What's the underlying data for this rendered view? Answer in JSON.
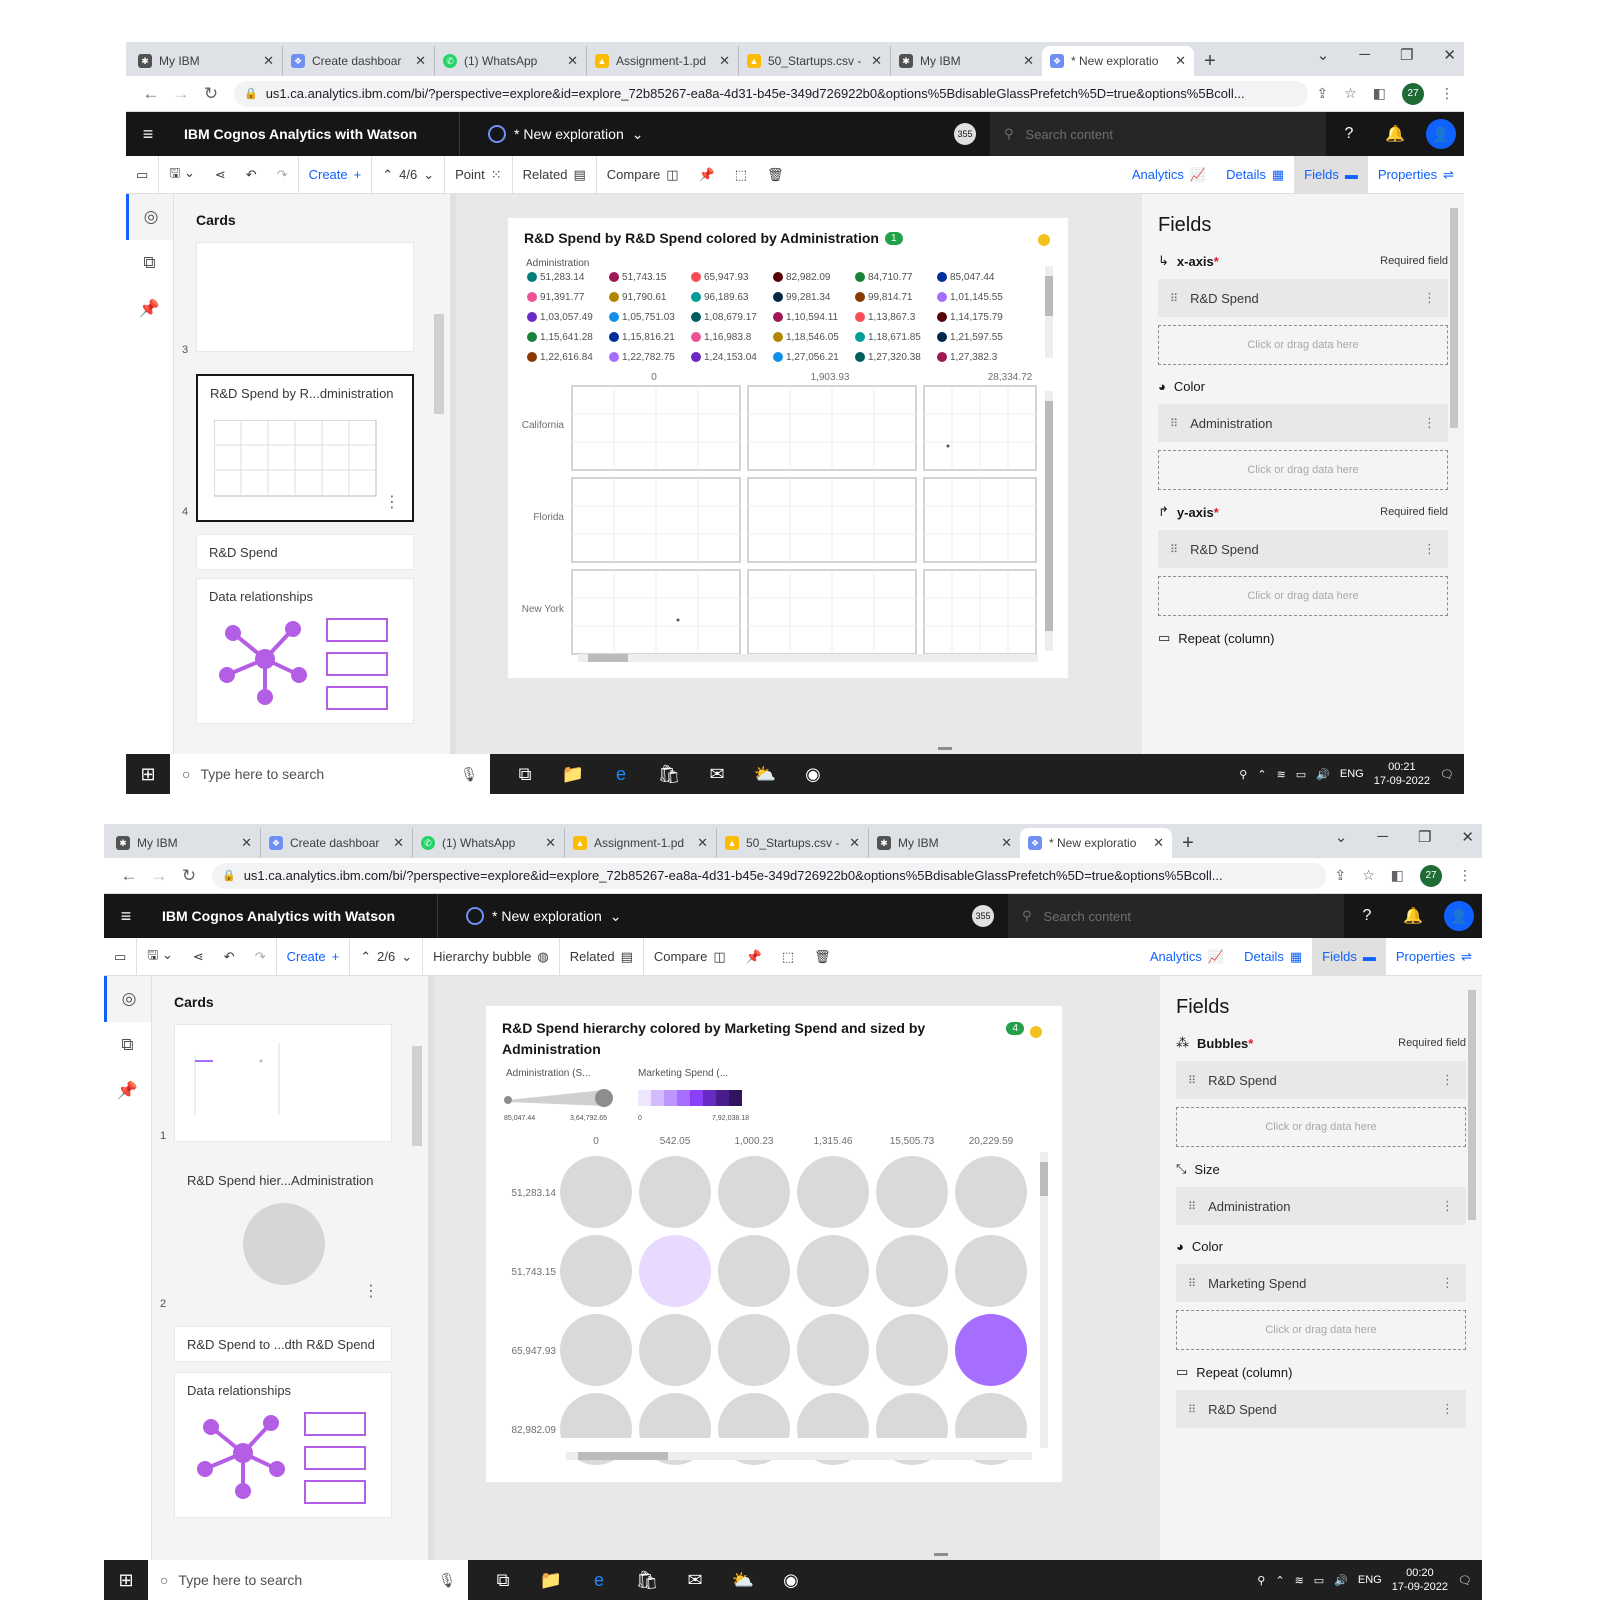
{
  "browser_tabs": [
    "My IBM",
    "Create dashboar",
    "(1) WhatsApp",
    "Assignment-1.pd",
    "50_Startups.csv -",
    "My IBM",
    "* New exploratio"
  ],
  "url": "us1.ca.analytics.ibm.com/bi/?perspective=explore&id=explore_72b85267-ea8a-4d31-b45e-349d726922b0&options%5BdisableGlassPrefetch%5D=true&options%5Bcoll...",
  "profile_badge": "27",
  "app_title": "IBM Cognos Analytics with Watson",
  "exploration_label": "* New exploration",
  "notifications_badge": "355",
  "search_placeholder": "Search content",
  "toolbar": {
    "create": "Create",
    "related": "Related",
    "compare": "Compare",
    "analytics": "Analytics",
    "details": "Details",
    "fields": "Fields",
    "properties": "Properties"
  },
  "cards_heading": "Cards",
  "fields_heading": "Fields",
  "required_field": "Required field",
  "drop_hint": "Click or drag data here",
  "data_relationships": "Data relationships",
  "taskbar": {
    "search": "Type here to search",
    "lang": "ENG",
    "date": "17-09-2022"
  },
  "shot1": {
    "page_pos": "4/6",
    "viz_type": "Point",
    "time": "00:21",
    "cards": [
      {
        "num": "3",
        "title": ""
      },
      {
        "num": "4",
        "title": "R&D Spend by R...dministration"
      },
      {
        "num": "",
        "title": "R&D Spend"
      }
    ],
    "viz_title": "R&D Spend by R&D Spend colored by Administration",
    "viz_count": "1",
    "legend_title": "Administration",
    "legend": [
      {
        "label": "51,283.14",
        "color": "#007d79"
      },
      {
        "label": "51,743.15",
        "color": "#9f1853"
      },
      {
        "label": "65,947.93",
        "color": "#fa4d56"
      },
      {
        "label": "82,982.09",
        "color": "#570408"
      },
      {
        "label": "84,710.77",
        "color": "#198038"
      },
      {
        "label": "85,047.44",
        "color": "#002d9c"
      },
      {
        "label": "91,391.77",
        "color": "#ee5396"
      },
      {
        "label": "91,790.61",
        "color": "#b28600"
      },
      {
        "label": "96,189.63",
        "color": "#009d9a"
      },
      {
        "label": "99,281.34",
        "color": "#012749"
      },
      {
        "label": "99,814.71",
        "color": "#8a3800"
      },
      {
        "label": "1,01,145.55",
        "color": "#a56eff"
      },
      {
        "label": "1,03,057.49",
        "color": "#6929c4"
      },
      {
        "label": "1,05,751.03",
        "color": "#1192e8"
      },
      {
        "label": "1,08,679.17",
        "color": "#005d5d"
      },
      {
        "label": "1,10,594.11",
        "color": "#9f1853"
      },
      {
        "label": "1,13,867.3",
        "color": "#fa4d56"
      },
      {
        "label": "1,14,175.79",
        "color": "#570408"
      },
      {
        "label": "1,15,641.28",
        "color": "#198038"
      },
      {
        "label": "1,15,816.21",
        "color": "#002d9c"
      },
      {
        "label": "1,16,983.8",
        "color": "#ee5396"
      },
      {
        "label": "1,18,546.05",
        "color": "#b28600"
      },
      {
        "label": "1,18,671.85",
        "color": "#009d9a"
      },
      {
        "label": "1,21,597.55",
        "color": "#012749"
      },
      {
        "label": "1,22,616.84",
        "color": "#8a3800"
      },
      {
        "label": "1,22,782.75",
        "color": "#a56eff"
      },
      {
        "label": "1,24,153.04",
        "color": "#6929c4"
      },
      {
        "label": "1,27,056.21",
        "color": "#1192e8"
      },
      {
        "label": "1,27,320.38",
        "color": "#005d5d"
      },
      {
        "label": "1,27,382.3",
        "color": "#9f1853"
      }
    ],
    "col_ticks": [
      "0",
      "1,903.93",
      "28,334.72"
    ],
    "row_labels": [
      "California",
      "Florida",
      "New York"
    ],
    "fields": {
      "xaxis": "x-axis",
      "xaxis_field": "R&D Spend",
      "color": "Color",
      "color_field": "Administration",
      "yaxis": "y-axis",
      "yaxis_field": "R&D Spend",
      "repeat": "Repeat (column)"
    }
  },
  "shot2": {
    "page_pos": "2/6",
    "viz_type": "Hierarchy bubble",
    "time": "00:20",
    "cards": [
      {
        "num": "1",
        "title": ""
      },
      {
        "num": "2",
        "title": "R&D Spend hier...Administration"
      },
      {
        "num": "",
        "title": "R&D Spend to ...dth R&D Spend"
      }
    ],
    "viz_title": "R&D Spend hierarchy colored by Marketing Spend and sized by Administration",
    "viz_count": "4",
    "size_legend": {
      "title": "Administration (S...",
      "min": "85,047.44",
      "max": "3,64,792.65"
    },
    "color_legend": {
      "title": "Marketing Spend (...",
      "min": "0",
      "max": "7,92,038.18"
    },
    "col_labels": [
      "0",
      "542.05",
      "1,000.23",
      "1,315.46",
      "15,505.73",
      "20,229.59"
    ],
    "row_labels": [
      "51,283.14",
      "51,743.15",
      "65,947.93",
      "82,982.09"
    ],
    "fields": {
      "bubbles": "Bubbles",
      "bubbles_field": "R&D Spend",
      "size": "Size",
      "size_field": "Administration",
      "color": "Color",
      "color_field": "Marketing Spend",
      "repeat": "Repeat (column)",
      "repeat_field": "R&D Spend"
    }
  },
  "chart_data": [
    {
      "type": "scatter",
      "title": "R&D Spend by R&D Spend colored by Administration",
      "xlabel": "R&D Spend",
      "ylabel": "R&D Spend",
      "facet_rows": [
        "California",
        "Florida",
        "New York"
      ],
      "facet_cols": [
        "0",
        "1,903.93",
        "28,334.72"
      ]
    },
    {
      "type": "bubble",
      "title": "R&D Spend hierarchy colored by Marketing Spend and sized by Administration",
      "columns": [
        "0",
        "542.05",
        "1,000.23",
        "1,315.46",
        "15,505.73",
        "20,229.59"
      ],
      "rows": [
        "51,283.14",
        "51,743.15",
        "65,947.93",
        "82,982.09"
      ],
      "highlighted": [
        {
          "row": "51,743.15",
          "col": "542.05",
          "color": "#e8daff"
        },
        {
          "row": "65,947.93",
          "col": "20,229.59",
          "color": "#a56eff"
        }
      ]
    }
  ]
}
